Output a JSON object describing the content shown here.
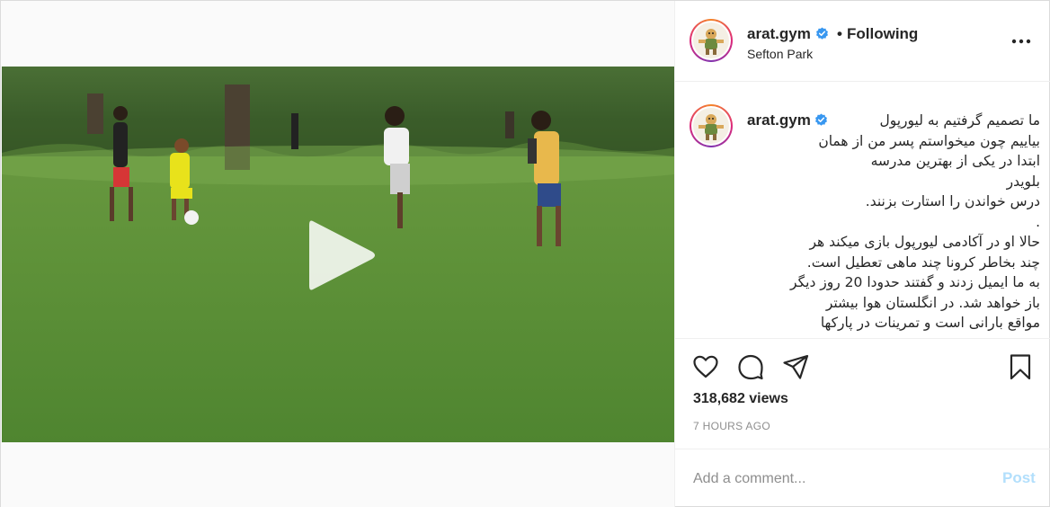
{
  "account": {
    "username": "arat.gym",
    "verified": true,
    "follow_state": "Following",
    "separator": "•",
    "location": "Sefton Park"
  },
  "caption": {
    "username": "arat.gym",
    "lines": [
      "ما تصمیم گرفتیم به لیورپول",
      "بیاییم چون میخواستم پسر من از همان",
      "ابتدا در یکی از بهترین مدرسه",
      "بلویدر",
      "درس خواندن را استارت بزنند.",
      ".",
      "حالا او در آکادمی لیورپول بازی میکند هر",
      "چند بخاطر کرونا چند ماهی تعطیل است.",
      "به ما ایمیل زدند و گفتند حدودا 20 روز دیگر",
      "باز خواهد شد. در انگلستان هوا بیشتر",
      "مواقع بارانی است و تمرینات در پارکها"
    ]
  },
  "stats": {
    "views": "318,682 views",
    "time": "7 HOURS AGO"
  },
  "comment": {
    "placeholder": "Add a comment...",
    "post_label": "Post"
  },
  "icons": {
    "more": "more-options-icon",
    "like": "heart-icon",
    "comment": "comment-bubble-icon",
    "share": "paper-plane-icon",
    "save": "bookmark-icon",
    "play": "play-icon",
    "verified": "verified-badge-icon"
  },
  "colors": {
    "verified": "#3897f0",
    "post_disabled": "#b2dffc",
    "muted": "#8e8e8e",
    "grass": "#5b8f3a"
  }
}
